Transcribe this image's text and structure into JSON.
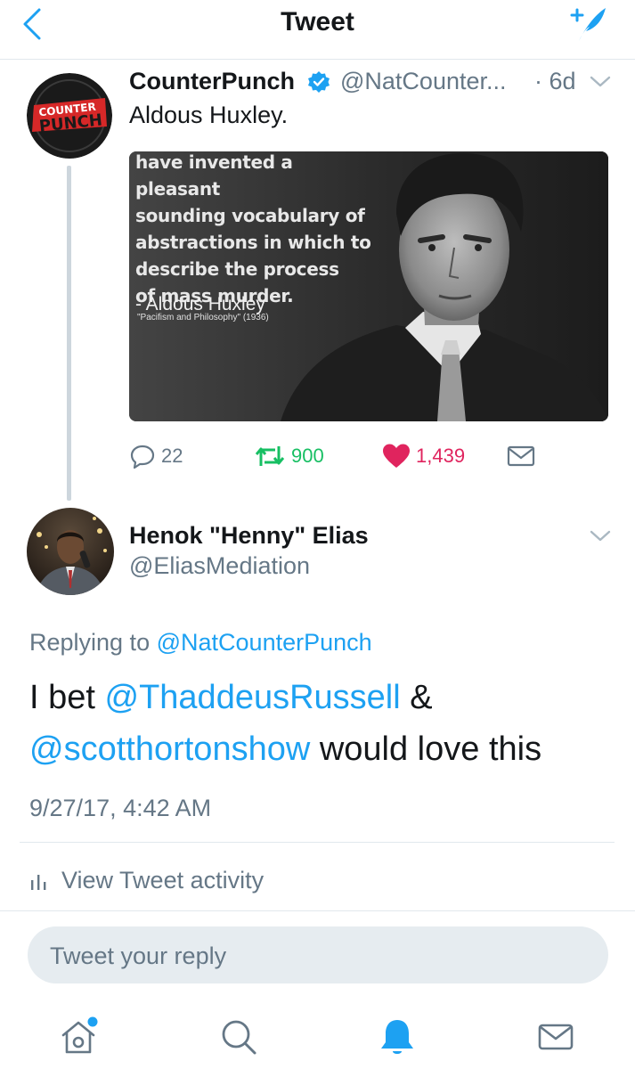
{
  "header": {
    "title": "Tweet",
    "back_icon": "chevron-left-icon",
    "compose_icon": "compose-tweet-icon",
    "accent": "#1da1f2"
  },
  "parent_tweet": {
    "display_name": "CounterPunch",
    "verified": true,
    "handle": "@NatCounter...",
    "time": "· 6d",
    "text": "Aldous Huxley.",
    "avatar_logo_lines": [
      "COUNTER",
      "PUNCH"
    ],
    "media": {
      "quote_lines": [
        "have invented a pleasant",
        "sounding vocabulary of",
        "abstractions in which to",
        "describe the process",
        "of mass murder."
      ],
      "author": "- Aldous Huxley",
      "source": "\"Pacifism and Philosophy\" (1936)"
    },
    "actions": {
      "replies": "22",
      "retweets": "900",
      "likes": "1,439",
      "retweet_color": "#17bf63",
      "like_color": "#e0245e"
    }
  },
  "reply_tweet": {
    "display_name": "Henok \"Henny\" Elias",
    "handle": "@EliasMediation",
    "replying_prefix": "Replying to",
    "replying_to": "@NatCounterPunch",
    "text_parts": {
      "p1": "I bet ",
      "m1": "@ThaddeusRussell",
      "p2": " & ",
      "m2": "@scotthortonshow",
      "p3": " would love this"
    },
    "timestamp": "9/27/17, 4:42 AM"
  },
  "activity_label": "View Tweet activity",
  "reply_placeholder": "Tweet your reply",
  "tabbar": {
    "items": [
      "home-icon",
      "search-icon",
      "notifications-icon",
      "messages-icon"
    ],
    "active": "notifications-icon",
    "has_home_badge": true
  }
}
